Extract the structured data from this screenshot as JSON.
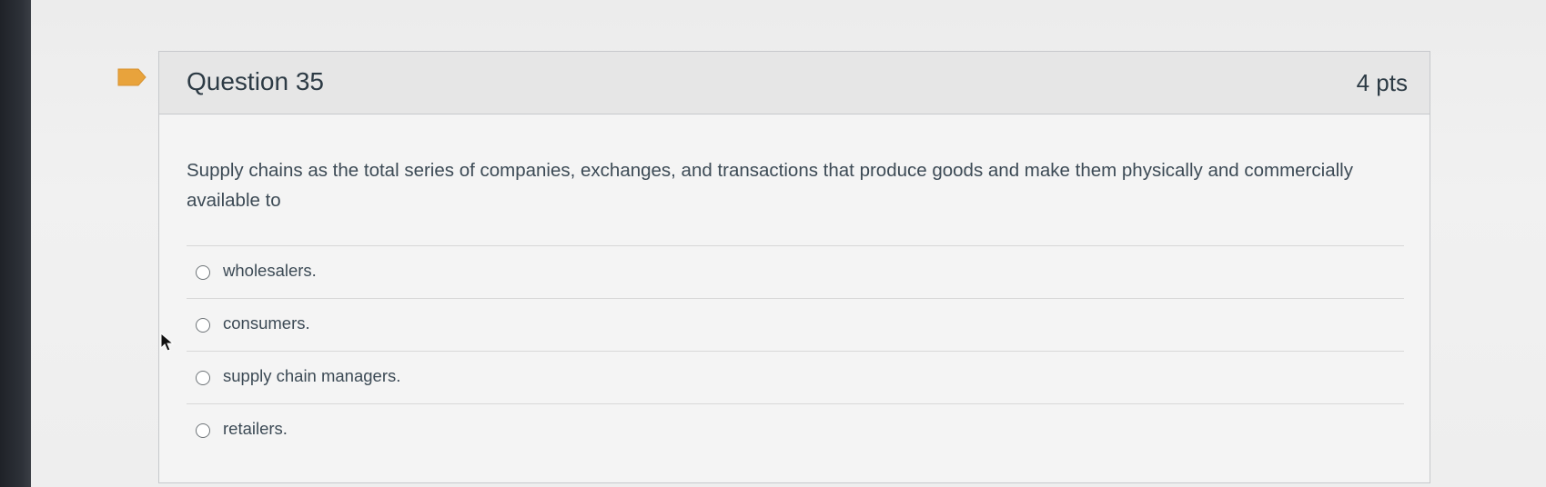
{
  "question": {
    "title": "Question 35",
    "points": "4 pts",
    "text": "Supply chains as the total series of companies, exchanges, and transactions that produce goods and make them physically and commercially available to",
    "flag_icon": "bookmark-flag-icon",
    "flag_color": "#e8a33c"
  },
  "answers": [
    {
      "label": "wholesalers.",
      "selected": false
    },
    {
      "label": "consumers.",
      "selected": false
    },
    {
      "label": "supply chain managers.",
      "selected": false
    },
    {
      "label": "retailers.",
      "selected": false
    }
  ]
}
